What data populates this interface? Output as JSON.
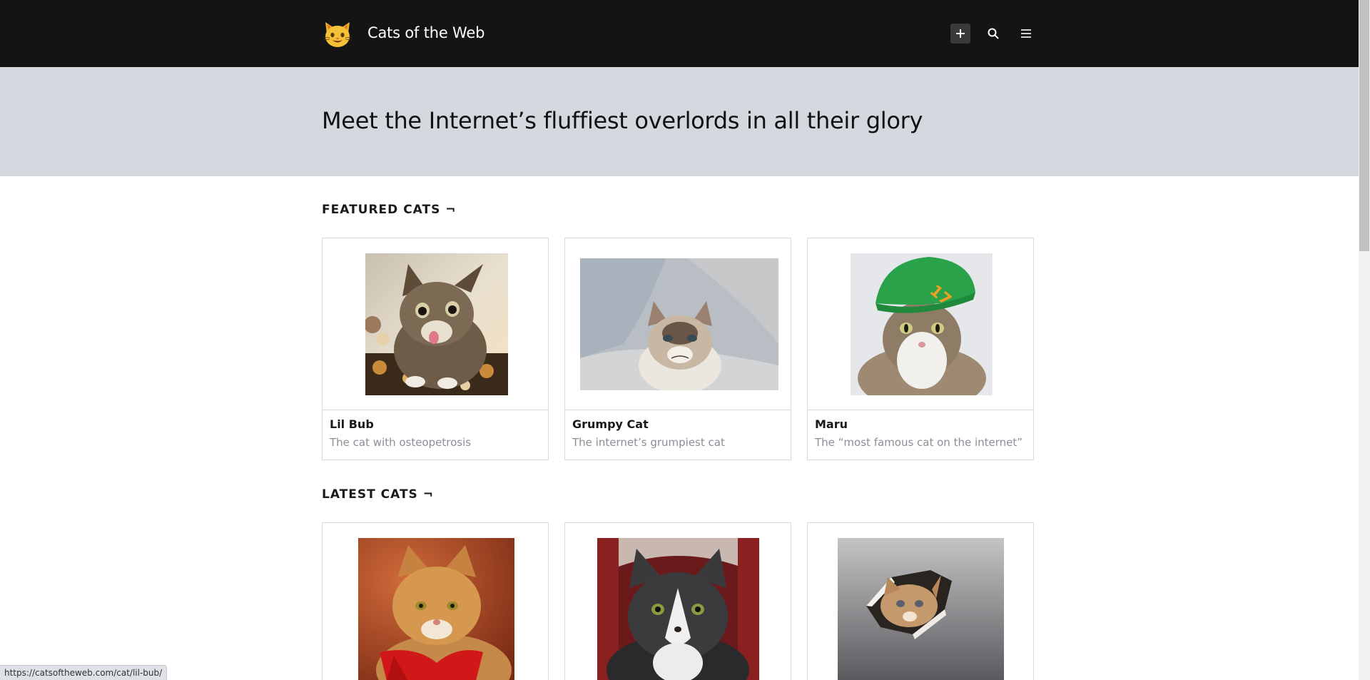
{
  "header": {
    "site_title": "Cats of the Web",
    "logo_icon": "cat-face-icon",
    "add_icon": "plus-icon",
    "search_icon": "search-icon",
    "menu_icon": "hamburger-menu-icon"
  },
  "hero": {
    "title": "Meet the Internet’s fluffiest overlords in all their glory"
  },
  "featured": {
    "heading": "FEATURED CATS ¬",
    "cards": [
      {
        "name": "Lil Bub",
        "description": "The cat with osteopetrosis"
      },
      {
        "name": "Grumpy Cat",
        "description": "The internet’s grumpiest cat"
      },
      {
        "name": "Maru",
        "description": "The “most famous cat on the internet”"
      }
    ]
  },
  "latest": {
    "heading": "LATEST CATS ¬"
  },
  "status_bar": {
    "url": "https://catsoftheweb.com/cat/lil-bub/"
  },
  "colors": {
    "header_bg": "#141414",
    "hero_bg": "#d4d9df",
    "card_border": "#dadada",
    "muted_text": "#8a8f96"
  }
}
